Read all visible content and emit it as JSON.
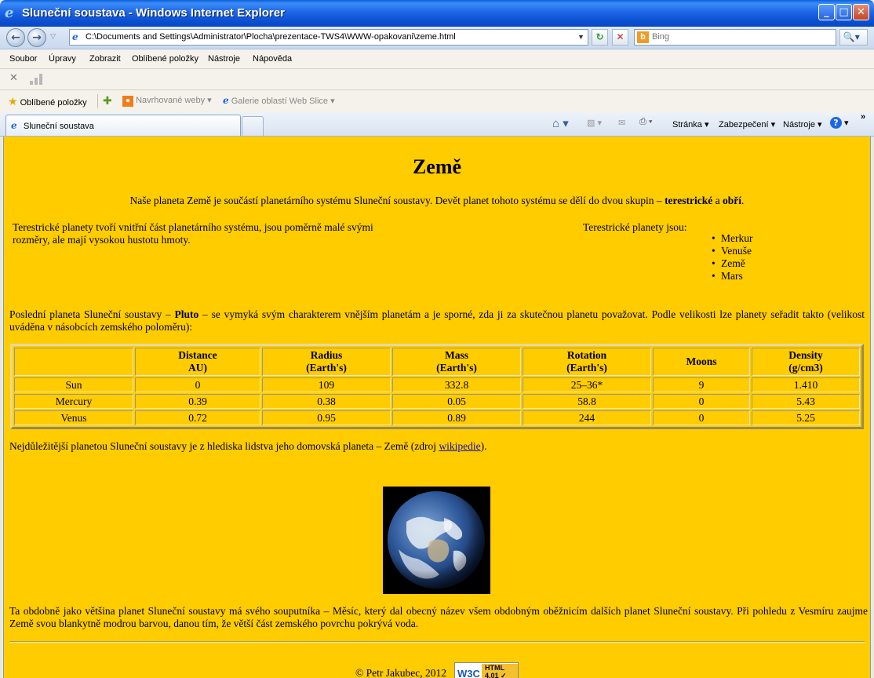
{
  "window": {
    "title": "Sluneční soustava - Windows Internet Explorer"
  },
  "address_bar": {
    "url": "C:\\Documents and Settings\\Administrator\\Plocha\\prezentace-TWS4\\WWW-opakovani\\zeme.html",
    "search_placeholder": "Bing"
  },
  "menu": [
    "Soubor",
    "Úpravy",
    "Zobrazit",
    "Oblíbené položky",
    "Nástroje",
    "Nápověda"
  ],
  "favorites_bar": {
    "favorites": "Oblíbené položky",
    "suggested": "Navrhované weby",
    "web_slice": "Galerie oblastí Web Slice"
  },
  "tab": {
    "label": "Sluneční soustava"
  },
  "command_bar": {
    "page": "Stránka",
    "security": "Zabezpečení",
    "tools": "Nástroje"
  },
  "page": {
    "heading": "Země",
    "intro_before": "Naše planeta Země je součástí planetárního systému Sluneční soustavy. Devět planet tohoto systému se dělí do dvou skupin – ",
    "intro_bold1": "terestrické",
    "intro_mid": " a ",
    "intro_bold2": "obří",
    "intro_end": ".",
    "terr_description": "Terestrické planety tvoří vnitřní část planetárního systému, jsou poměrně malé svými rozměry, ale mají vysokou hustotu hmoty.",
    "terr_list_label": "Terestrické planety jsou:",
    "terr_planets": [
      "Merkur",
      "Venuše",
      "Země",
      "Mars"
    ],
    "pluto_before": "Poslední planeta Sluneční soustavy – ",
    "pluto_bold": "Pluto",
    "pluto_after": " – se vymyká svým charakterem vnějším planetám a je sporné, zda ji za skutečnou planetu považovat. Podle velikosti lze planety seřadit takto (velikost uváděna v násobcích zemského poloměru):",
    "table": {
      "headers": [
        [
          "",
          ""
        ],
        [
          "Distance",
          "AU)"
        ],
        [
          "Radius",
          "(Earth's)"
        ],
        [
          "Mass",
          "(Earth's)"
        ],
        [
          "Rotation",
          "(Earth's)"
        ],
        [
          "Moons",
          ""
        ],
        [
          "Density",
          "(g/cm3)"
        ]
      ],
      "rows": [
        [
          "Sun",
          "0",
          "109",
          "332.8",
          "25–36*",
          "9",
          "1.410"
        ],
        [
          "Mercury",
          "0.39",
          "0.38",
          "0.05",
          "58.8",
          "0",
          "5.43"
        ],
        [
          "Venus",
          "0.72",
          "0.95",
          "0.89",
          "244",
          "0",
          "5.25"
        ]
      ]
    },
    "wiki_before": "Nejdůležitější planetou Sluneční soustavy je z hlediska lidstva jeho domovská planeta – Země (zdroj ",
    "wiki_link": "wikipedie",
    "wiki_after": ").",
    "moon_paragraph": "Ta obdobně jako většina planet Sluneční soustavy má svého souputníka – Měsíc, který dal obecný název všem obdobným oběžnicím dalších planet Sluneční soustavy. Při pohledu z Vesmíru zaujme Země svou blankytně modrou barvou, danou tím, že větší část zemského povrchu pokrývá voda.",
    "footer": "© Petr Jakubec, 2012",
    "badge_w3c": "W3C",
    "badge_html": "HTML",
    "badge_version": "4.01"
  },
  "colors": {
    "page_background": "#ffcc00",
    "titlebar": "#0a5fd8"
  }
}
